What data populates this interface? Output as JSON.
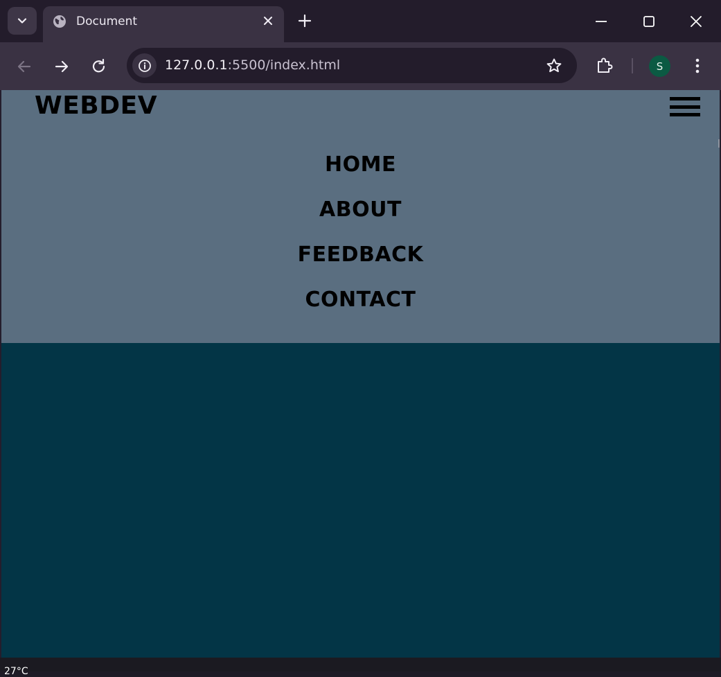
{
  "browser": {
    "tab": {
      "title": "Document",
      "favicon": "globe-icon"
    },
    "address_bar": {
      "host": "127.0.0.1",
      "rest": ":5500/index.html"
    },
    "profile_initial": "S",
    "colors": {
      "tab_strip": "#231c2b",
      "toolbar": "#3a3243",
      "avatar": "#0b5a43"
    }
  },
  "page": {
    "logo": "WEBDEV",
    "nav": [
      {
        "label": "HOME"
      },
      {
        "label": "ABOUT"
      },
      {
        "label": "FEEDBACK"
      },
      {
        "label": "CONTACT"
      }
    ],
    "colors": {
      "header_bg": "#5a6e80",
      "body_bg": "#033546",
      "text": "#000000"
    }
  },
  "taskbar": {
    "weather": "27°C"
  }
}
